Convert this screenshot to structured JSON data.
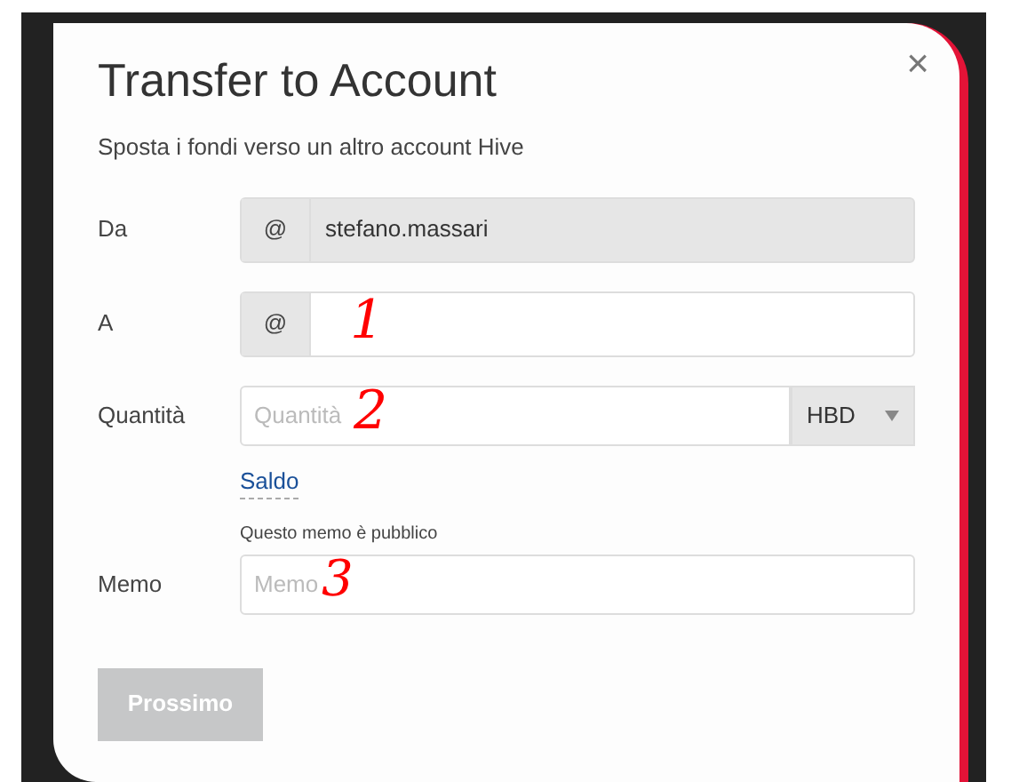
{
  "dialog": {
    "title": "Transfer to Account",
    "subtitle": "Sposta i fondi verso un altro account Hive",
    "close": "×"
  },
  "fields": [
    {
      "label": "Da",
      "kind": "account",
      "prefix": "@",
      "value": "stefano.massari",
      "disabled": true
    },
    {
      "label": "A",
      "kind": "account",
      "prefix": "@",
      "disabled": false,
      "annotation": "1"
    },
    {
      "label": "Quantità",
      "kind": "amount",
      "placeholder": "Quantità",
      "currency": "HBD",
      "link": "Saldo",
      "annotation": "2"
    },
    {
      "label": "Memo",
      "kind": "memo",
      "hint": "Questo memo è pubblico",
      "placeholder": "Memo",
      "annotation": "3"
    }
  ],
  "next_button": {
    "label": "Prossimo",
    "disabled": true
  }
}
